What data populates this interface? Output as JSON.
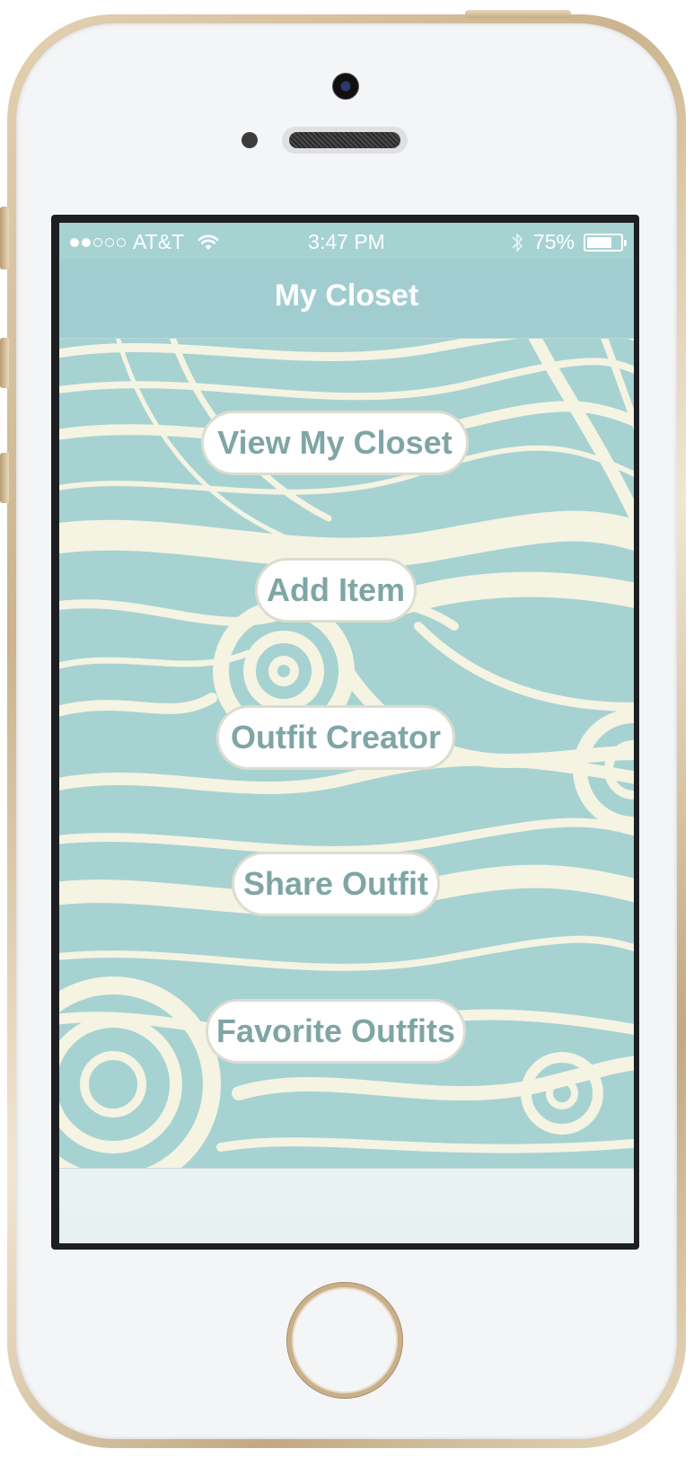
{
  "status_bar": {
    "carrier": "AT&T",
    "signal_bars_filled": 2,
    "signal_bars_total": 5,
    "time": "3:47 PM",
    "battery_percent_label": "75%",
    "battery_level": 0.75
  },
  "nav": {
    "title": "My Closet"
  },
  "menu": {
    "buttons": [
      {
        "label": "View My Closet"
      },
      {
        "label": "Add Item"
      },
      {
        "label": "Outfit Creator"
      },
      {
        "label": "Share Outfit"
      },
      {
        "label": "Favorite Outfits"
      }
    ]
  },
  "colors": {
    "background_teal": "#a6d2d2",
    "wave_cream": "#f5f3e2",
    "nav_bar": "#a2cdd0",
    "button_text": "#7fa5a5",
    "button_border": "#dcdcd0",
    "phone_trim": "#c9b08a"
  },
  "icons": {
    "wifi": "wifi-icon",
    "bluetooth": "bluetooth-icon",
    "battery": "battery-icon"
  }
}
